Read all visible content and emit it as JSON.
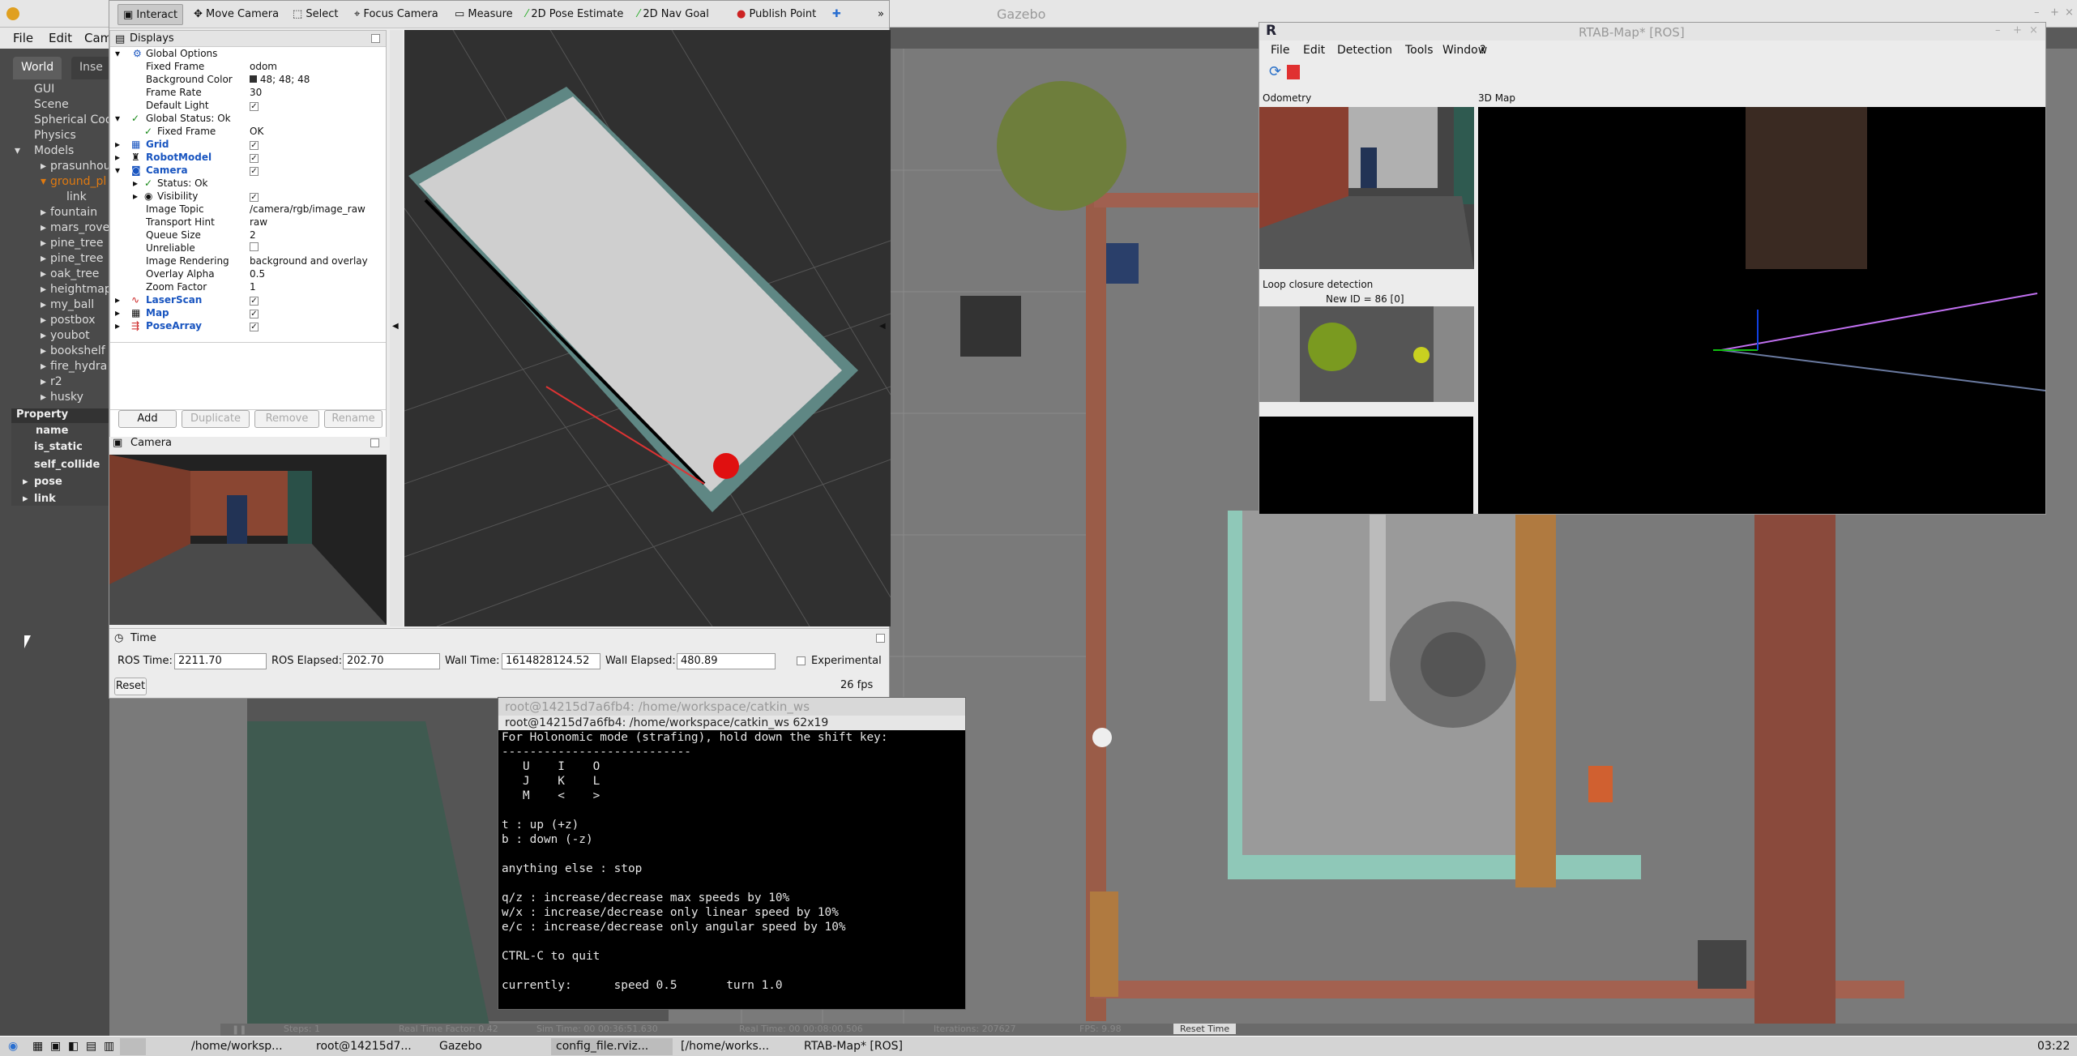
{
  "gazebo": {
    "title": "Gazebo",
    "menu": [
      "File",
      "Edit",
      "Cam"
    ],
    "tabs": [
      "World",
      "Inse"
    ],
    "tree": [
      "GUI",
      "Scene",
      "Spherical Coo",
      "Physics",
      "Models",
      "prasunhou",
      "ground_pl",
      "link",
      "fountain",
      "mars_rove",
      "pine_tree",
      "pine_tree",
      "oak_tree",
      "heightmap",
      "my_ball",
      "postbox",
      "youbot",
      "bookshelf",
      "fire_hydra",
      "r2",
      "husky"
    ],
    "property": {
      "header": "Property",
      "rows": [
        "name",
        "is_static",
        "self_collide",
        "pose",
        "link"
      ]
    },
    "bottom": [
      "Steps: 1",
      "Real Time Factor: 0.42",
      "Sim Time: 00 00:36:51.630",
      "Real Time: 00 00:08:00.506",
      "Iterations: 207627",
      "FPS: 9.98",
      "Reset Time"
    ]
  },
  "rviz": {
    "toolbar": [
      "Interact",
      "Move Camera",
      "Select",
      "Focus Camera",
      "Measure",
      "2D Pose Estimate",
      "2D Nav Goal",
      "Publish Point"
    ],
    "displays_title": "Displays",
    "rows": [
      {
        "k": "Global Options",
        "v": ""
      },
      {
        "k": "Fixed Frame",
        "v": "odom"
      },
      {
        "k": "Background Color",
        "v": "48; 48; 48"
      },
      {
        "k": "Frame Rate",
        "v": "30"
      },
      {
        "k": "Default Light",
        "v": ""
      },
      {
        "k": "Global Status: Ok",
        "v": ""
      },
      {
        "k": "Fixed Frame",
        "v": "OK"
      },
      {
        "k": "Grid",
        "v": ""
      },
      {
        "k": "RobotModel",
        "v": ""
      },
      {
        "k": "Camera",
        "v": ""
      },
      {
        "k": "Status: Ok",
        "v": ""
      },
      {
        "k": "Visibility",
        "v": ""
      },
      {
        "k": "Image Topic",
        "v": "/camera/rgb/image_raw"
      },
      {
        "k": "Transport Hint",
        "v": "raw"
      },
      {
        "k": "Queue Size",
        "v": "2"
      },
      {
        "k": "Unreliable",
        "v": ""
      },
      {
        "k": "Image Rendering",
        "v": "background and overlay"
      },
      {
        "k": "Overlay Alpha",
        "v": "0.5"
      },
      {
        "k": "Zoom Factor",
        "v": "1"
      },
      {
        "k": "LaserScan",
        "v": ""
      },
      {
        "k": "Map",
        "v": ""
      },
      {
        "k": "PoseArray",
        "v": ""
      }
    ],
    "buttons": [
      "Add",
      "Duplicate",
      "Remove",
      "Rename"
    ],
    "camera_title": "Camera",
    "time": {
      "title": "Time",
      "ros_time_label": "ROS Time:",
      "ros_time": "2211.70",
      "ros_elapsed_label": "ROS Elapsed:",
      "ros_elapsed": "202.70",
      "wall_time_label": "Wall Time:",
      "wall_time": "1614828124.52",
      "wall_elapsed_label": "Wall Elapsed:",
      "wall_elapsed": "480.89",
      "experimental": "Experimental",
      "reset": "Reset",
      "fps": "26 fps"
    }
  },
  "rtab": {
    "title": "RTAB-Map* [ROS]",
    "menu": [
      "File",
      "Edit",
      "Detection",
      "Tools",
      "Window",
      "?"
    ],
    "odometry": "Odometry",
    "map3d": "3D Map",
    "loop": "Loop closure detection",
    "new_id": "New ID = 86 [0]"
  },
  "terminal": {
    "title": "root@14215d7a6fb4: /home/workspace/catkin_ws",
    "subtitle": "root@14215d7a6fb4: /home/workspace/catkin_ws 62x19",
    "lines": [
      "For Holonomic mode (strafing), hold down the shift key:",
      "---------------------------",
      "   U    I    O",
      "   J    K    L",
      "   M    <    >",
      "",
      "t : up (+z)",
      "b : down (-z)",
      "",
      "anything else : stop",
      "",
      "q/z : increase/decrease max speeds by 10%",
      "w/x : increase/decrease only linear speed by 10%",
      "e/c : increase/decrease only angular speed by 10%",
      "",
      "CTRL-C to quit",
      "",
      "currently:      speed 0.5       turn 1.0"
    ]
  },
  "taskbar": {
    "items": [
      "/home/worksp...",
      "root@14215d7...",
      "Gazebo",
      "config_file.rviz...",
      "[/home/works...",
      "RTAB-Map* [ROS]"
    ],
    "clock": "03:22"
  }
}
